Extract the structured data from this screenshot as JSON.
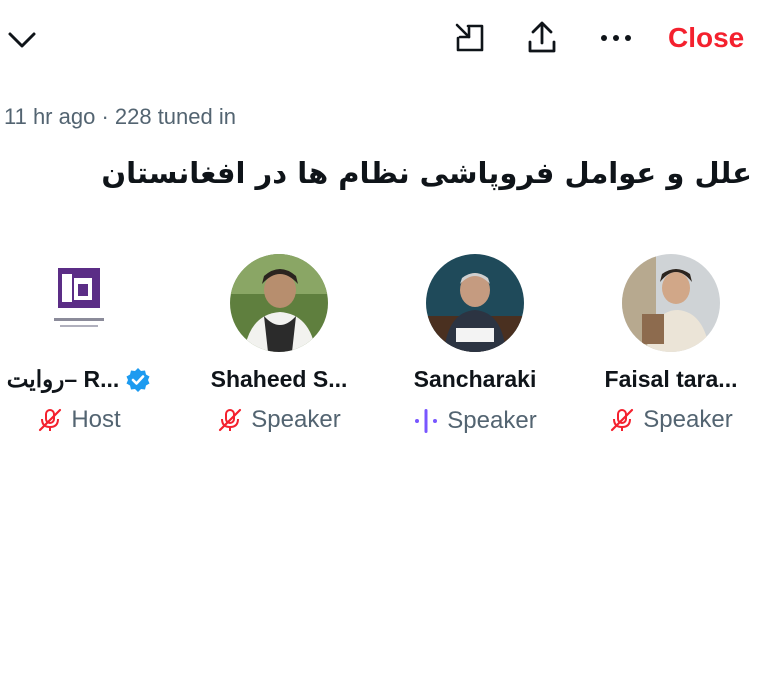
{
  "header": {
    "collapse_icon": "chevron-down-icon",
    "minimize_icon": "picture-in-picture-icon",
    "share_icon": "share-upload-icon",
    "more_icon": "more-horizontal-icon",
    "close_label": "Close"
  },
  "space": {
    "meta": "11 hr ago · 228 tuned in",
    "title": "علل و عوامل فروپاشی نظام ها در افغانستان"
  },
  "participants": [
    {
      "name": "روایت– R...",
      "verified": true,
      "role": "Host",
      "mic": "muted-mic-icon"
    },
    {
      "name": "Shaheed S...",
      "role": "Speaker",
      "mic": "muted-mic-icon"
    },
    {
      "name": "Sancharaki",
      "role": "Speaker",
      "mic": "speaking-waveform-icon"
    },
    {
      "name": "Faisal tara...",
      "role": "Speaker",
      "mic": "muted-mic-icon"
    }
  ],
  "colors": {
    "close": "#f4212e",
    "muted_mic": "#f4212e",
    "speaking": "#7856ff",
    "verified": "#1d9bf0",
    "secondary_text": "#536471"
  }
}
